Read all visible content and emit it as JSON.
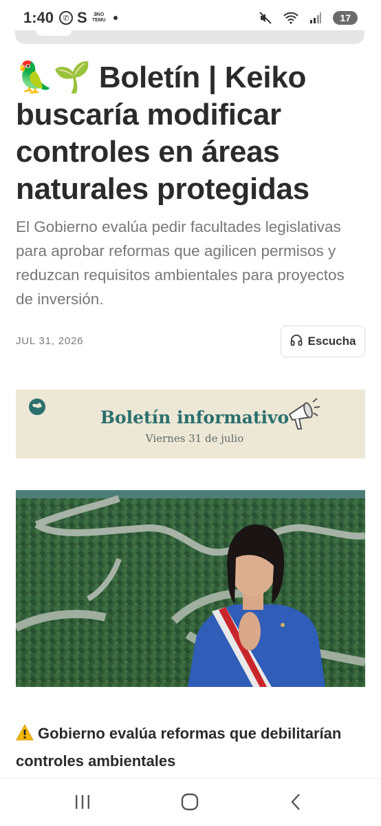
{
  "status_bar": {
    "time": "1:40",
    "whatsapp_glyph": "✆",
    "s_app_glyph": "S",
    "temu_glyph": "ƎNO TEMU",
    "battery_level": "17"
  },
  "article": {
    "title_emoji": "🦜🌱",
    "title": "Boletín | Keiko buscaría modificar controles en áreas naturales protegidas",
    "subtitle": "El Gobierno evalúa pedir facultades legislativas para aprobar reformas que agilicen permisos y reduzcan requisitos ambientales para proyectos de inversión.",
    "date": "JUL 31, 2026",
    "listen_label": "Escucha"
  },
  "banner": {
    "title": "Boletín informativo",
    "subtitle": "Viernes 31 de julio"
  },
  "section": {
    "heading": "Gobierno evalúa reformas que debilitarían controles ambientales"
  },
  "icons": {
    "listen": "headphones-icon",
    "warning": "warning-icon",
    "recents": "recent-apps-icon",
    "home": "home-icon",
    "back": "back-icon"
  }
}
